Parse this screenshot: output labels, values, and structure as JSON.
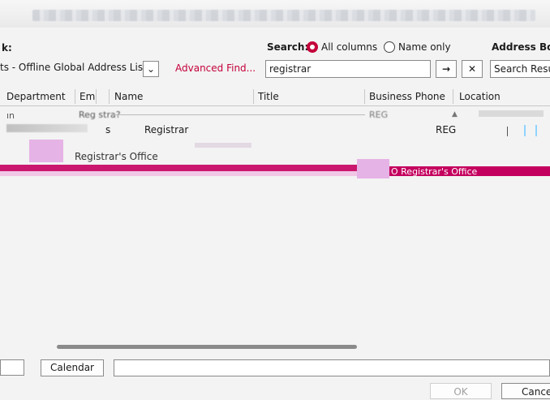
{
  "header": {
    "label_prefix": "k:",
    "search_label": "Search:",
    "radio_all": "All columns",
    "radio_name": "Name only",
    "address_book_label": "Address Book"
  },
  "address_list": {
    "value": "ts - Offline Global Address List",
    "advanced_find": "Advanced Find..."
  },
  "search": {
    "value": "registrar",
    "go_glyph": "→",
    "clear_glyph": "✕",
    "results_value": "Search Results"
  },
  "columns": {
    "department": "Department",
    "em": "Em",
    "name": "Name",
    "title": "Title",
    "business_phone": "Business Phone",
    "location": "Location"
  },
  "rows": [
    {
      "dept": "ın",
      "em": "Reg stra?",
      "title": "",
      "phone": "REG",
      "loc": ""
    },
    {
      "dept": "",
      "em": "s",
      "title": "Registrar",
      "phone": "REG",
      "loc": ""
    },
    {
      "dept": "",
      "em": "Registrar's Office",
      "title": "",
      "phone": "",
      "loc": "O Registrar's Office"
    }
  ],
  "bottom": {
    "calendar_label": "Calendar",
    "ok_label": "OK",
    "cancel_label": "Cancel"
  },
  "colors": {
    "accent": "#c4003a",
    "selection_magenta": "#c4005e",
    "selection_pink": "#e6b3e6"
  }
}
